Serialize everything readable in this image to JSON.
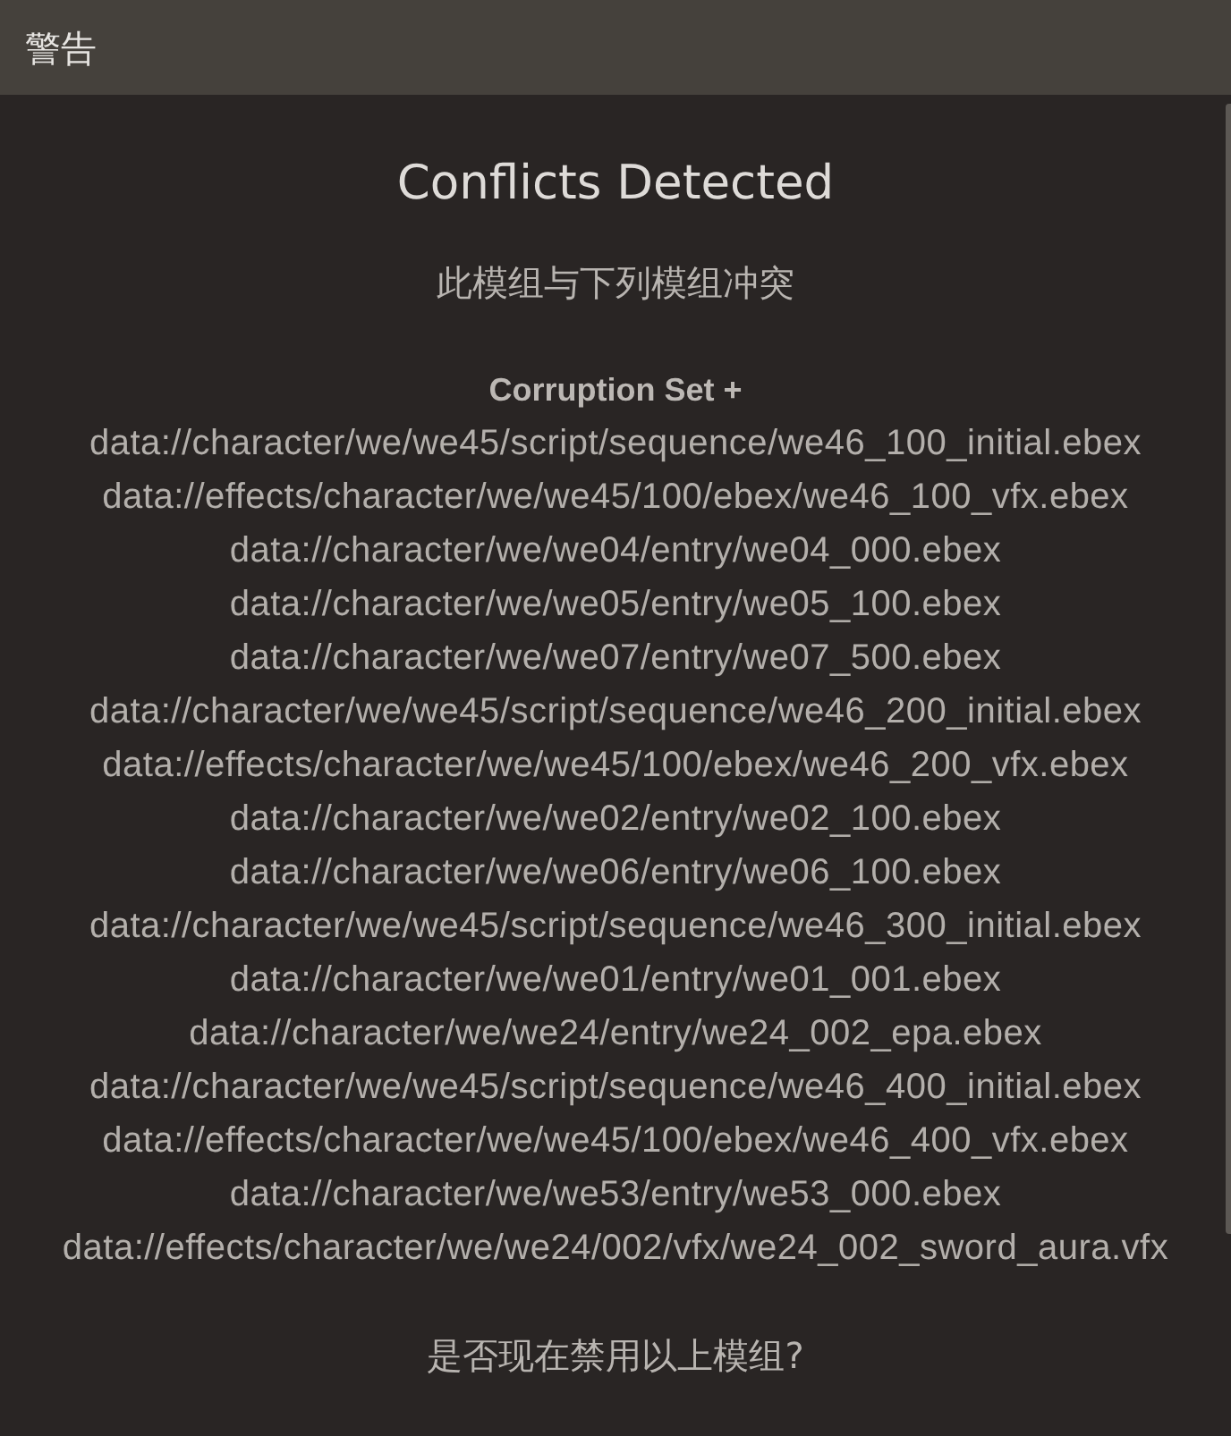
{
  "window": {
    "title": "警告"
  },
  "dialog": {
    "heading": "Conflicts Detected",
    "message": "此模组与下列模组冲突",
    "conflicts": [
      {
        "mod": "Corruption Set +",
        "files": [
          "data://character/we/we45/script/sequence/we46_100_initial.ebex",
          "data://effects/character/we/we45/100/ebex/we46_100_vfx.ebex",
          "data://character/we/we04/entry/we04_000.ebex",
          "data://character/we/we05/entry/we05_100.ebex",
          "data://character/we/we07/entry/we07_500.ebex",
          "data://character/we/we45/script/sequence/we46_200_initial.ebex",
          "data://effects/character/we/we45/100/ebex/we46_200_vfx.ebex",
          "data://character/we/we02/entry/we02_100.ebex",
          "data://character/we/we06/entry/we06_100.ebex",
          "data://character/we/we45/script/sequence/we46_300_initial.ebex",
          "data://character/we/we01/entry/we01_001.ebex",
          "data://character/we/we24/entry/we24_002_epa.ebex",
          "data://character/we/we45/script/sequence/we46_400_initial.ebex",
          "data://effects/character/we/we45/100/ebex/we46_400_vfx.ebex",
          "data://character/we/we53/entry/we53_000.ebex",
          "data://effects/character/we/we24/002/vfx/we24_002_sword_aura.vfx"
        ]
      }
    ],
    "question": "是否现在禁用以上模组?"
  }
}
